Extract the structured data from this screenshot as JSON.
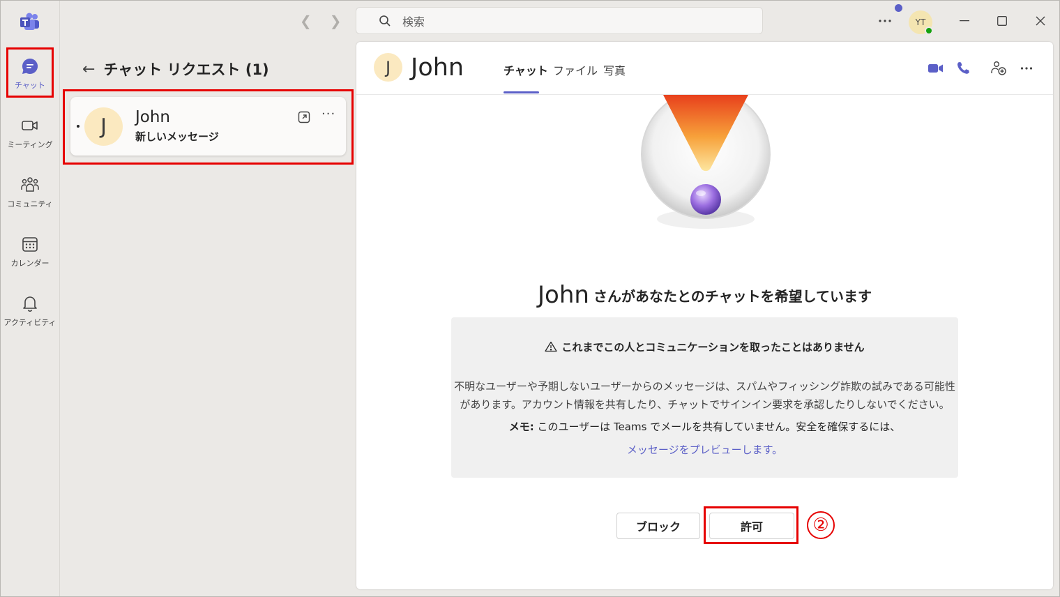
{
  "titlebar": {
    "search_placeholder": "検索",
    "avatar_initials": "YT"
  },
  "rail": {
    "items": [
      {
        "label": "チャット",
        "icon": "chat-icon"
      },
      {
        "label": "ミーティング",
        "icon": "video-icon"
      },
      {
        "label": "コミュニティ",
        "icon": "people-community-icon"
      },
      {
        "label": "カレンダー",
        "icon": "calendar-icon"
      },
      {
        "label": "アクティビティ",
        "icon": "bell-icon"
      }
    ]
  },
  "list": {
    "title": "チャット リクエスト (1)",
    "card": {
      "initial": "J",
      "name": "John",
      "subtitle": "新しいメッセージ",
      "more": "···"
    }
  },
  "main": {
    "initial": "J",
    "name": "John",
    "tabs": [
      "チャット",
      "ファイル",
      "写真"
    ],
    "headline_name": "John",
    "headline_text": "さんがあなたとのチャットを希望しています",
    "warning_title": "これまでこの人とコミュニケーションを取ったことはありません",
    "warning_line1": "不明なユーザーや予期しないユーザーからのメッセージは、スパムやフィッシング詐欺の試みである可能性",
    "warning_line2": "があります。アカウント情報を共有したり、チャットでサインイン要求を承認したりしないでください。",
    "note_label": "メモ:",
    "note_text": "このユーザーは Teams でメールを共有していません。安全を確保するには、",
    "preview_link": "メッセージをプレビューします。",
    "block_label": "ブロック",
    "allow_label": "許可",
    "more": "···"
  },
  "annotation": {
    "step": "②",
    "color": "#e60000"
  },
  "colors": {
    "accent": "#5b5fc7",
    "presence": "#13a10e",
    "avatar_bg": "#fbe9c0"
  }
}
